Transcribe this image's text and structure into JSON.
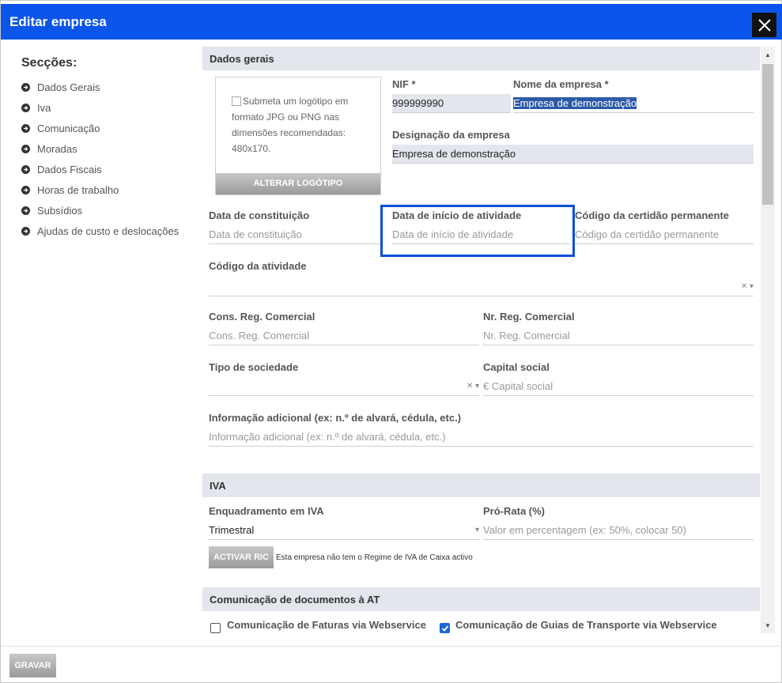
{
  "dialog": {
    "title": "Editar empresa"
  },
  "sidebar": {
    "heading": "Secções:",
    "items": [
      {
        "label": "Dados Gerais"
      },
      {
        "label": "Iva"
      },
      {
        "label": "Comunicação"
      },
      {
        "label": "Moradas"
      },
      {
        "label": "Dados Fiscais"
      },
      {
        "label": "Horas de trabalho"
      },
      {
        "label": "Subsídios"
      },
      {
        "label": "Ajudas de custo e deslocações"
      }
    ]
  },
  "dados_gerais": {
    "section_title": "Dados gerais",
    "logo": {
      "alt_text": "Submeta um logótipo em formato JPG ou PNG nas dimensões recomendadas: 480x170.",
      "button_label": "ALTERAR LOGÓTIPO"
    },
    "nif": {
      "label": "NIF *",
      "value": "999999990"
    },
    "nome_empresa": {
      "label": "Nome da empresa *",
      "value": "Empresa de demonstração"
    },
    "designacao": {
      "label": "Designação da empresa",
      "value": "Empresa de demonstração"
    },
    "data_constituicao": {
      "label": "Data de constituição",
      "placeholder": "Data de constituição"
    },
    "data_inicio": {
      "label": "Data de início de atividade",
      "placeholder": "Data de início de atividade"
    },
    "certidao": {
      "label": "Código da certidão permanente",
      "placeholder": "Código da certidão permanente"
    },
    "codigo_atividade": {
      "label": "Código da atividade"
    },
    "cons_reg": {
      "label": "Cons. Reg. Comercial",
      "placeholder": "Cons. Reg. Comercial"
    },
    "nr_reg": {
      "label": "Nr. Reg. Comercial",
      "placeholder": "Nr. Reg. Comercial"
    },
    "tipo_sociedade": {
      "label": "Tipo de sociedade"
    },
    "capital_social": {
      "label": "Capital social",
      "placeholder": "€ Capital social"
    },
    "info_adicional": {
      "label": "Informação adicional (ex: n.º de alvará, cédula, etc.)",
      "placeholder": "Informação adicional (ex: n.º de alvará, cédula, etc.)"
    }
  },
  "iva": {
    "section_title": "IVA",
    "enquadramento": {
      "label": "Enquadramento em IVA",
      "value": "Trimestral"
    },
    "pro_rata": {
      "label": "Pró-Rata (%)",
      "placeholder": "Valor em percentagem (ex: 50%, colocar 50)"
    },
    "ric_button": "ACTIVAR RIC",
    "ric_note": "Esta empresa não tem o Regime de IVA de Caixa activo"
  },
  "comunicacao": {
    "section_title": "Comunicação de documentos à AT",
    "faturas_label": "Comunicação de Faturas via Webservice",
    "faturas_checked": false,
    "guias_label": "Comunicação de Guias de Transporte via Webservice",
    "guias_checked": true
  },
  "footer": {
    "save_label": "GRAVAR"
  },
  "colors": {
    "titlebar": "#0b55ea",
    "section_bg": "#e3e6ec",
    "highlight": "#0b4fd8"
  }
}
